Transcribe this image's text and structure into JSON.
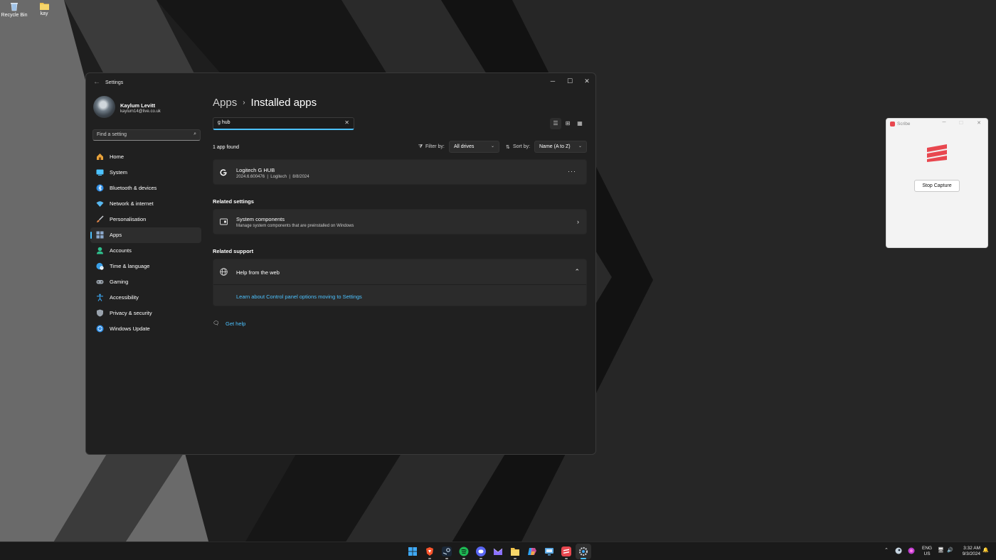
{
  "desktop": {
    "icons": [
      {
        "label": "Recycle Bin"
      },
      {
        "label": "kay"
      }
    ]
  },
  "settings_window": {
    "title": "Settings",
    "controls": {
      "minimize": "─",
      "maximize": "☐",
      "close": "✕"
    },
    "profile": {
      "name": "Kaylum Levitt",
      "email": "kaylum14@live.co.uk"
    },
    "find_placeholder": "Find a setting",
    "nav": [
      {
        "label": "Home",
        "icon": "home-icon",
        "color": "#e8a33b"
      },
      {
        "label": "System",
        "icon": "system-icon",
        "color": "#4cc2ff"
      },
      {
        "label": "Bluetooth & devices",
        "icon": "bluetooth-icon",
        "color": "#2f8de4"
      },
      {
        "label": "Network & internet",
        "icon": "wifi-icon",
        "color": "#58b8f0"
      },
      {
        "label": "Personalisation",
        "icon": "brush-icon",
        "color": "#e9884a"
      },
      {
        "label": "Apps",
        "icon": "apps-icon",
        "color": "#8aa6c9",
        "active": true
      },
      {
        "label": "Accounts",
        "icon": "person-icon",
        "color": "#2fbf8d"
      },
      {
        "label": "Time & language",
        "icon": "globe-clock-icon",
        "color": "#3aa0e8"
      },
      {
        "label": "Gaming",
        "icon": "gamepad-icon",
        "color": "#9aa3ad"
      },
      {
        "label": "Accessibility",
        "icon": "accessibility-icon",
        "color": "#3aa0e8"
      },
      {
        "label": "Privacy & security",
        "icon": "shield-icon",
        "color": "#9aa3ad"
      },
      {
        "label": "Windows Update",
        "icon": "update-icon",
        "color": "#2f8de4"
      }
    ],
    "breadcrumb": {
      "parent": "Apps",
      "separator": "›",
      "current": "Installed apps"
    },
    "search": {
      "value": "g hub"
    },
    "result_count": "1 app found",
    "filter": {
      "label": "Filter by:",
      "value": "All drives"
    },
    "sort": {
      "label": "Sort by:",
      "value": "Name (A to Z)"
    },
    "app": {
      "name": "Logitech G HUB",
      "version": "2024.6.600476",
      "publisher": "Logitech",
      "date": "8/8/2024",
      "sep": "|",
      "more": "···"
    },
    "related_settings": {
      "heading": "Related settings",
      "title": "System components",
      "subtitle": "Manage system components that are preinstalled on Windows"
    },
    "related_support": {
      "heading": "Related support",
      "title": "Help from the web",
      "link": "Learn about Control panel options moving to Settings"
    },
    "get_help": "Get help"
  },
  "scribe": {
    "title": "Scribe",
    "button": "Stop Capture",
    "accent": "#e8474f"
  },
  "taskbar": {
    "lang": {
      "line1": "ENG",
      "line2": "US"
    },
    "clock": {
      "time": "3:32 AM",
      "date": "9/3/2024"
    }
  }
}
